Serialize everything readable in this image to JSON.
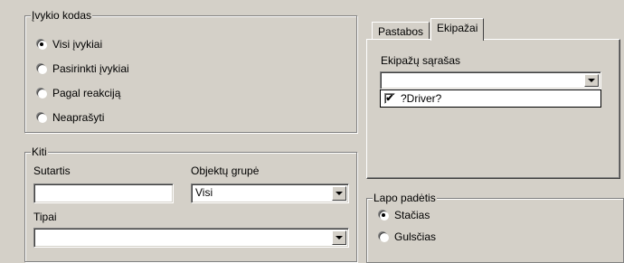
{
  "event_code_group": {
    "title": "Įvykio kodas",
    "options": [
      {
        "label": "Visi įvykiai",
        "selected": true
      },
      {
        "label": "Pasirinkti įvykiai",
        "selected": false
      },
      {
        "label": "Pagal reakciją",
        "selected": false
      },
      {
        "label": "Neaprašyti",
        "selected": false
      }
    ]
  },
  "other_group": {
    "title": "Kiti",
    "contract_label": "Sutartis",
    "contract_value": "",
    "object_group_label": "Objektų grupė",
    "object_group_value": "Visi",
    "types_label": "Tipai",
    "types_value": ""
  },
  "tabs": [
    {
      "label": "Pastabos",
      "active": false
    },
    {
      "label": "Ekipažai",
      "active": true
    }
  ],
  "crews_panel": {
    "list_label": "Ekipažų sąrašas",
    "combo_value": "",
    "items": [
      {
        "label": "?Driver?",
        "checked": true
      }
    ]
  },
  "orientation_group": {
    "title": "Lapo padėtis",
    "options": [
      {
        "label": "Stačias",
        "selected": true
      },
      {
        "label": "Gulsčias",
        "selected": false
      }
    ]
  },
  "check_mark": "✔"
}
